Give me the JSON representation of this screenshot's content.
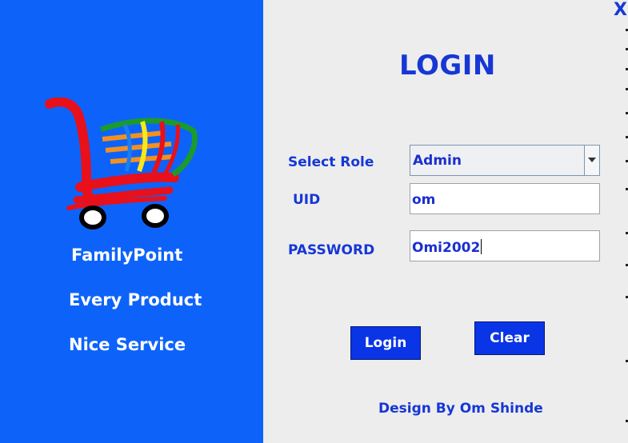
{
  "window": {
    "close_label": "X"
  },
  "branding": {
    "name": "FamilyPoint",
    "slogan_1": "Every Product",
    "slogan_2": "Nice Service",
    "logo_icon": "shopping-cart-icon",
    "panel_color": "#0d63f9"
  },
  "login": {
    "title": "LOGIN",
    "role_label": "Select Role",
    "role_value": "Admin",
    "uid_label": "UID",
    "uid_value": "om",
    "password_label": "PASSWORD",
    "password_value": "Omi2002",
    "login_button": "Login",
    "clear_button": "Clear",
    "accent_color": "#1637d6"
  },
  "footer": {
    "credit": "Design By Om Shinde"
  }
}
